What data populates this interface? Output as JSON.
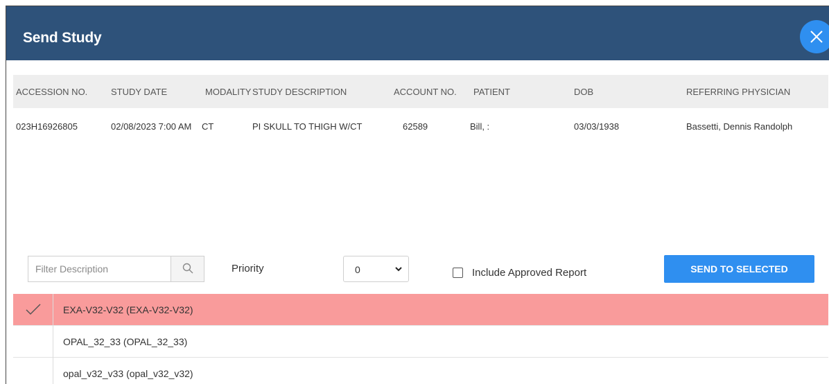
{
  "dialog": {
    "title": "Send Study",
    "close_icon": "close-icon"
  },
  "study_table": {
    "columns": [
      "ACCESSION NO.",
      "STUDY DATE",
      "MODALITY",
      "STUDY DESCRIPTION",
      "ACCOUNT NO.",
      "PATIENT",
      "DOB",
      "REFERRING PHYSICIAN"
    ],
    "rows": [
      [
        "023H16926805",
        "02/08/2023 7:00 AM",
        "CT",
        "PI SKULL TO THIGH W/CT",
        "62589",
        "Bill, :",
        "03/03/1938",
        "Bassetti, Dennis Randolph"
      ]
    ]
  },
  "controls": {
    "filter_placeholder": "Filter Description",
    "filter_value": "",
    "search_icon": "search-icon",
    "priority_label": "Priority",
    "priority_value": "0",
    "include_report_label": "Include Approved Report",
    "include_report_checked": false,
    "send_label": "SEND TO SELECTED"
  },
  "destinations": [
    {
      "label": "EXA-V32-V32 (EXA-V32-V32)",
      "selected": true
    },
    {
      "label": "OPAL_32_33 (OPAL_32_33)",
      "selected": false
    },
    {
      "label": "opal_v32_v33 (opal_v32_v32)",
      "selected": false
    }
  ],
  "colors": {
    "titlebar": "#2e527a",
    "accent": "#2f8ff0",
    "selected_row": "#f99b9b",
    "header_bg": "#eeeeee"
  }
}
